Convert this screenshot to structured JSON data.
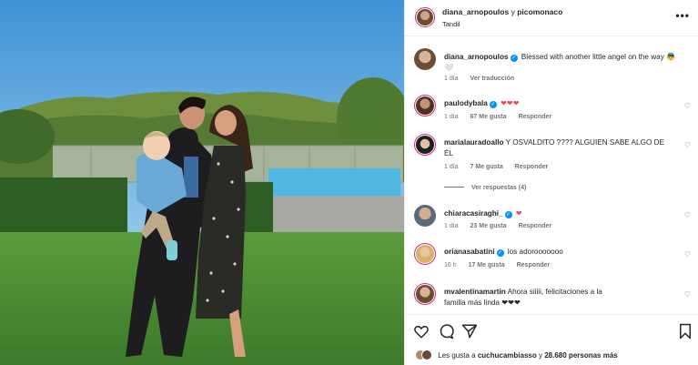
{
  "post": {
    "author": "diana_arnopoulos",
    "conjunction": "y",
    "collaborator": "picomonaco",
    "location": "Tandil",
    "more_label": "•••"
  },
  "caption": {
    "user": "diana_arnopoulos",
    "text": "Blessed with another little angel on the way",
    "emoji": "👼🤍",
    "time": "1 día",
    "translate": "Ver traducción"
  },
  "comments": [
    {
      "user": "paulodybala",
      "verified": true,
      "text": "❤❤❤",
      "time": "1 día",
      "likes": "67 Me gusta",
      "reply": "Responder"
    },
    {
      "user": "marialauradoallo",
      "verified": false,
      "text": "Y OSVALDITO ???? ALGUIEN SABE ALGO DE ÉL",
      "time": "1 día",
      "likes": "7 Me gusta",
      "reply": "Responder",
      "view_replies": "Ver respuestas (4)"
    },
    {
      "user": "chiaracasiraghi_",
      "verified": true,
      "text": "❤",
      "time": "1 día",
      "likes": "23 Me gusta",
      "reply": "Responder"
    },
    {
      "user": "orianasabatini",
      "verified": true,
      "text": "los adorooooooo",
      "time": "16 h",
      "likes": "17 Me gusta",
      "reply": "Responder"
    },
    {
      "user": "mvalentinamartin",
      "verified": false,
      "text": "Ahora siiiii, felicitaciones a la familia más linda ❤❤❤"
    }
  ],
  "liked_by": {
    "prefix": "Les gusta a",
    "user": "cuchucambiasso",
    "middle": "y",
    "count": "28.680 personas más"
  },
  "colors": {
    "accent": "#0095f6",
    "heart": "#ed4956",
    "muted": "#737373"
  }
}
